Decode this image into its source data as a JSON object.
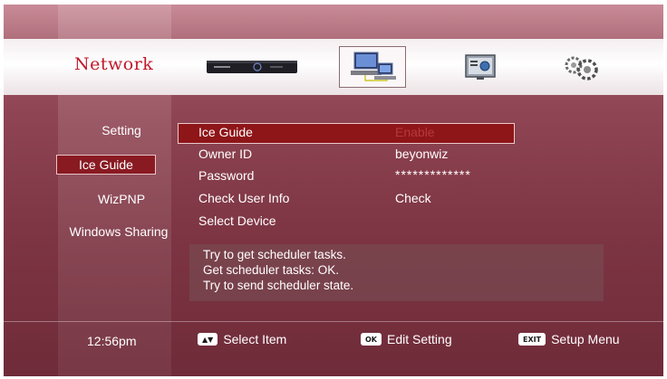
{
  "header": {
    "title": "Network",
    "icons": [
      "settop-box-icon",
      "network-computers-icon",
      "monitor-settings-icon",
      "gears-icon"
    ]
  },
  "sidebar": {
    "items": [
      {
        "label": "Setting",
        "active": false
      },
      {
        "label": "Ice Guide",
        "active": true
      },
      {
        "label": "WizPNP",
        "active": false
      },
      {
        "label": "Windows Sharing",
        "active": false
      }
    ]
  },
  "settings": [
    {
      "label": "Ice Guide",
      "value": "Enable",
      "selected": true
    },
    {
      "label": "Owner ID",
      "value": "beyonwiz"
    },
    {
      "label": "Password",
      "value": "*************"
    },
    {
      "label": "Check User Info",
      "value": "Check"
    },
    {
      "label": "Select Device",
      "value": ""
    }
  ],
  "messages": [
    "Try to get scheduler tasks.",
    "Get scheduler tasks: OK.",
    "Try to send scheduler state."
  ],
  "footer": {
    "time": "12:56pm",
    "hints": [
      {
        "key": "▲▼",
        "label": "Select Item"
      },
      {
        "key": "OK",
        "label": "Edit Setting"
      },
      {
        "key": "EXIT",
        "label": "Setup Menu"
      }
    ]
  },
  "colors": {
    "accent_red": "#c0182a",
    "highlight": "#8e1518",
    "background": "#7c3442"
  }
}
